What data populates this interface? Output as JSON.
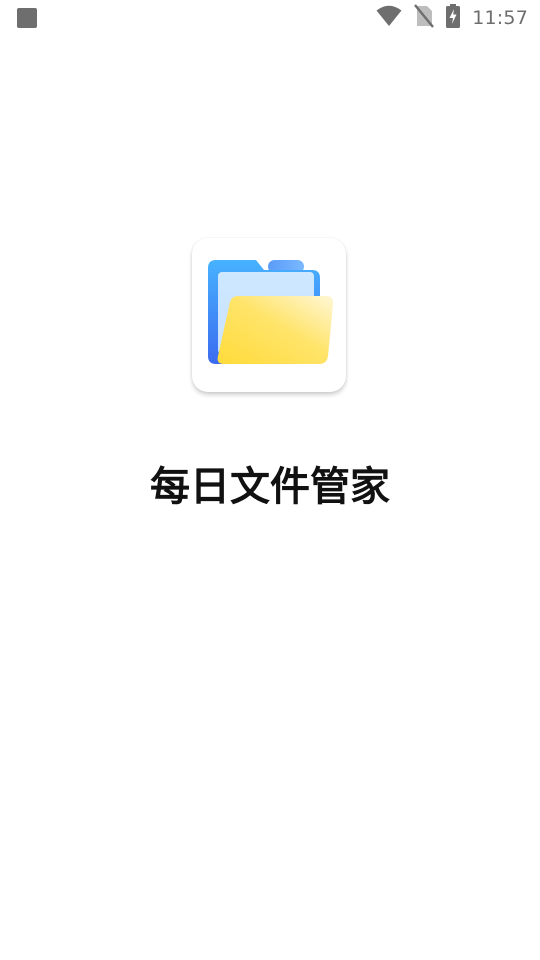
{
  "status_bar": {
    "time": "11:57",
    "icons": [
      "notification-square-icon",
      "wifi-icon",
      "no-sim-icon",
      "battery-charging-icon"
    ],
    "icon_color": "#6e6e6e"
  },
  "splash": {
    "app_name": "每日文件管家",
    "icon": "folder-icon",
    "colors": {
      "folder_back": "#3d8ef5",
      "folder_front": "#ffd84a",
      "background": "#ffffff"
    }
  }
}
